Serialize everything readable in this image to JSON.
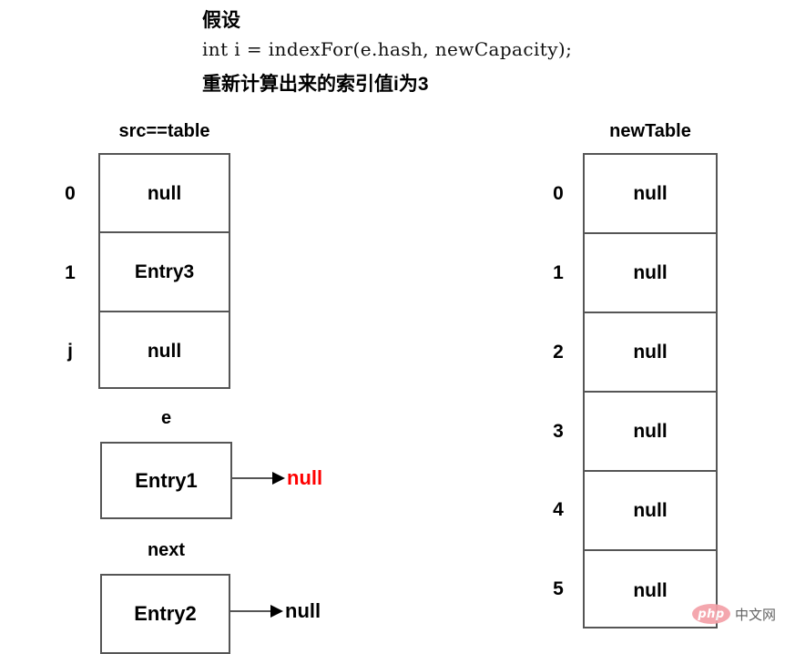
{
  "header": {
    "line1": "假设",
    "line2": "int i = indexFor(e.hash, newCapacity);",
    "line3": "重新计算出来的索引值i为3"
  },
  "src_table": {
    "title": "src==table",
    "indices": [
      "0",
      "1",
      "j"
    ],
    "values": [
      "null",
      "Entry3",
      "null"
    ]
  },
  "new_table": {
    "title": "newTable",
    "indices": [
      "0",
      "1",
      "2",
      "3",
      "4",
      "5"
    ],
    "values": [
      "null",
      "null",
      "null",
      "null",
      "null",
      "null"
    ]
  },
  "nodes": [
    {
      "label": "e",
      "value": "Entry1",
      "next": "null",
      "next_color": "#ff0000"
    },
    {
      "label": "next",
      "value": "Entry2",
      "next": "null",
      "next_color": "#000000"
    }
  ],
  "watermark": {
    "badge": "php",
    "text": "中文网"
  },
  "colors": {
    "border": "#555555",
    "text": "#000000",
    "highlight": "#ff0000",
    "background": "#ffffff"
  }
}
